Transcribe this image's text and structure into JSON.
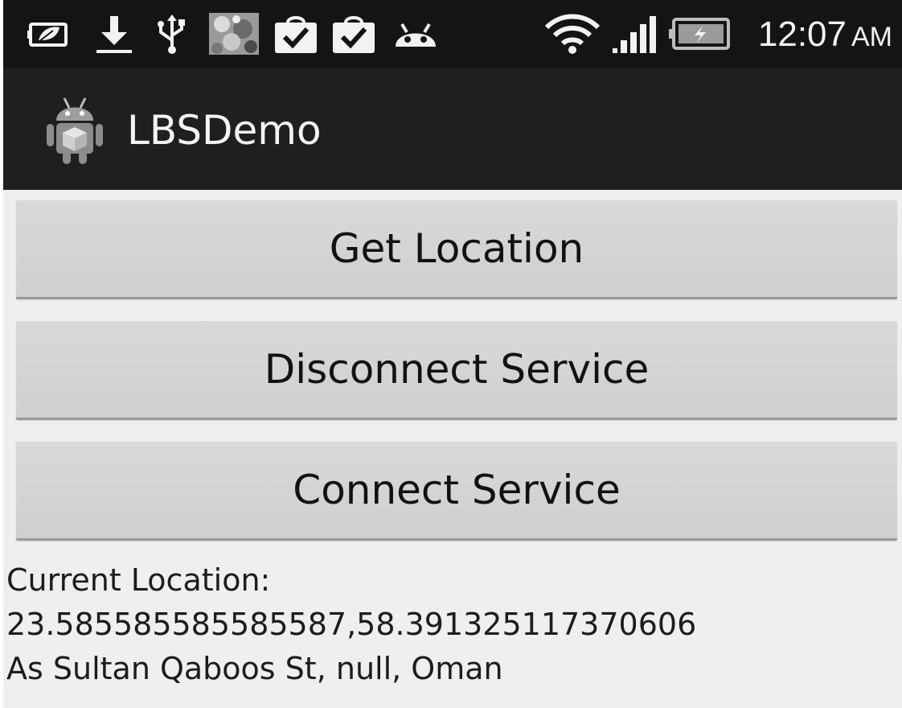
{
  "status_bar": {
    "icons": [
      "battery-saver-icon",
      "download-icon",
      "usb-icon",
      "photo-thumbnail-icon",
      "shopping-bag-check-icon",
      "shopping-bag-check-icon",
      "android-icon",
      "wifi-icon",
      "signal-icon",
      "battery-charging-icon"
    ],
    "time": "12:07",
    "ampm": "AM"
  },
  "action_bar": {
    "title": "LBSDemo",
    "icon": "android-app-icon"
  },
  "buttons": {
    "get_location": "Get Location",
    "disconnect_service": "Disconnect Service",
    "connect_service": "Connect Service"
  },
  "location": {
    "label": "Current Location:",
    "coordinates": "23.585585585585587,58.391325117370606",
    "address": "As Sultan Qaboos St, null, Oman"
  },
  "colors": {
    "status_bar_bg": "#141414",
    "action_bar_bg": "#1f1f1f",
    "content_bg": "#efefef",
    "button_bg": "#d4d4d4"
  }
}
